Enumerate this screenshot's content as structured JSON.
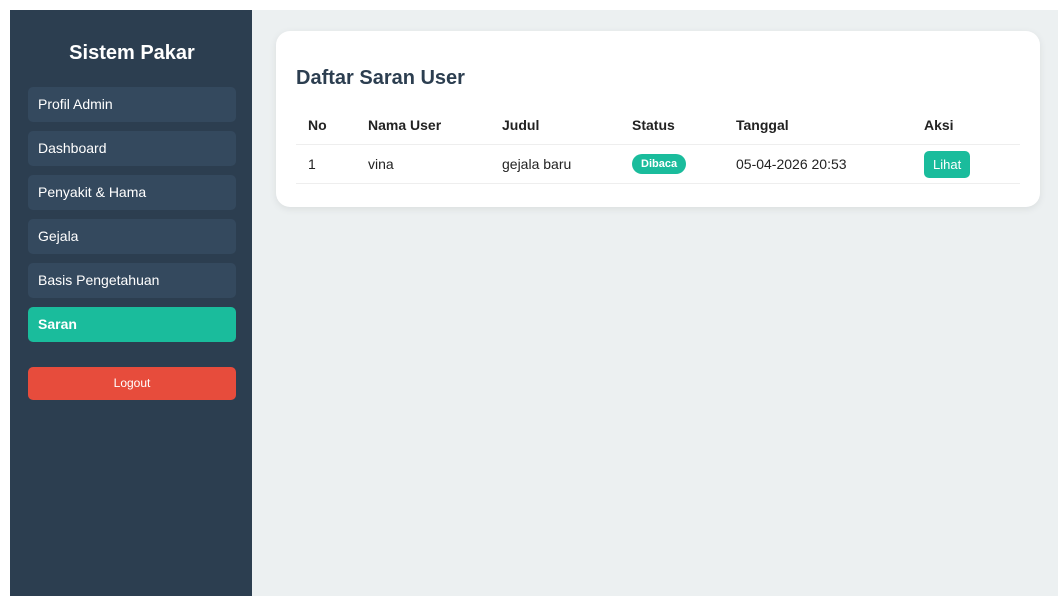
{
  "sidebar": {
    "brand": "Sistem Pakar",
    "items": [
      {
        "label": "Profil Admin"
      },
      {
        "label": "Dashboard"
      },
      {
        "label": "Penyakit & Hama"
      },
      {
        "label": "Gejala"
      },
      {
        "label": "Basis Pengetahuan"
      },
      {
        "label": "Saran",
        "active": true
      }
    ],
    "logout_label": "Logout"
  },
  "main": {
    "title": "Daftar Saran User",
    "table": {
      "headers": [
        "No",
        "Nama User",
        "Judul",
        "Status",
        "Tanggal",
        "Aksi"
      ],
      "rows": [
        {
          "no": "1",
          "user": "vina",
          "judul": "gejala baru",
          "status": "Dibaca",
          "tanggal": "05-04-2026 20:53",
          "aksi": "Lihat"
        }
      ]
    }
  },
  "colors": {
    "sidebar_bg": "#2c3e50",
    "menu_item_bg": "#34495e",
    "accent": "#1abc9c",
    "danger": "#e74c3c",
    "main_bg": "#ecf0f1",
    "title": "#2c3e50"
  }
}
